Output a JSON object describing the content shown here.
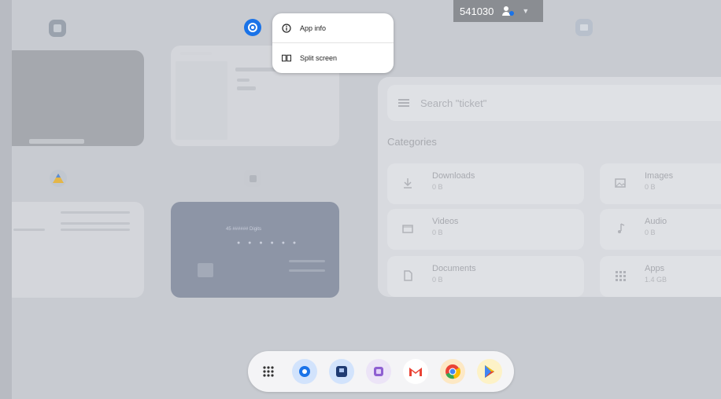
{
  "status": {
    "id_text": "541030"
  },
  "context_menu": {
    "app_info": "App info",
    "split_screen": "Split screen"
  },
  "files_app": {
    "search_placeholder": "Search \"ticket\"",
    "categories_title": "Categories",
    "tiles": [
      {
        "name": "Downloads",
        "size": "0 B",
        "icon": "download-icon"
      },
      {
        "name": "Images",
        "size": "0 B",
        "icon": "image-icon"
      },
      {
        "name": "Videos",
        "size": "0 B",
        "icon": "video-icon"
      },
      {
        "name": "Audio",
        "size": "0 B",
        "icon": "music-note-icon"
      },
      {
        "name": "Documents",
        "size": "0 B",
        "icon": "document-icon"
      },
      {
        "name": "Apps",
        "size": "1.4 GB",
        "icon": "apps-grid-icon"
      }
    ]
  },
  "recents": {
    "lock_title": "45 ###### Digits"
  },
  "dock": {
    "items": [
      "app-drawer-icon",
      "settings-icon",
      "files-icon",
      "gallery-icon",
      "gmail-icon",
      "chrome-icon",
      "play-store-icon"
    ]
  },
  "colors": {
    "accent": "#1a73e8",
    "menu_bg": "#ffffff",
    "scrim": "#c8cbd1"
  }
}
